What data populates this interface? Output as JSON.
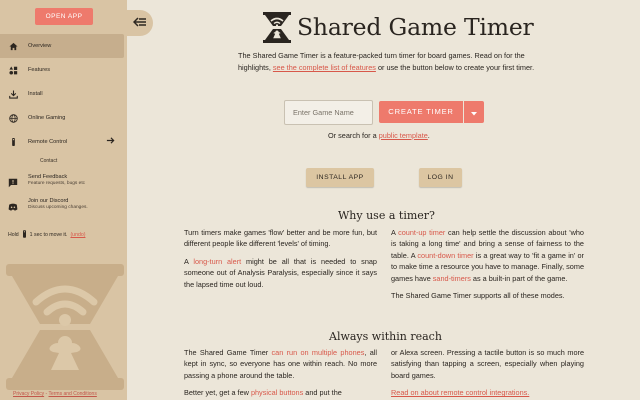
{
  "sidebar": {
    "open_app": "OPEN APP",
    "items": [
      {
        "label": "Overview",
        "icon": "home-icon"
      },
      {
        "label": "Features",
        "icon": "features-icon"
      },
      {
        "label": "Install",
        "icon": "download-icon"
      },
      {
        "label": "Online Gaming",
        "icon": "globe-icon"
      },
      {
        "label": "Remote Control",
        "icon": "remote-icon"
      }
    ],
    "contact": "Contact",
    "feedback_title": "Send Feedback",
    "feedback_sub": "Feature requests, bugs etc",
    "discord_title": "Join our Discord",
    "discord_sub": "Discuss upcoming changes.",
    "hold_text": "Hold",
    "hold_text2": "1 sec to move it.",
    "undo": "(undo)",
    "privacy": "Privacy Policy",
    "sep": " - ",
    "terms": "Terms and Conditions"
  },
  "header": {
    "title": "Shared Game Timer"
  },
  "intro": {
    "text1": "The Shared Game Timer is a feature-packed turn timer for board games. Read on for the highlights, ",
    "link": "see the complete list of features",
    "text2": " or use the button below to create your first timer."
  },
  "create": {
    "placeholder": "Enter Game Name",
    "button": "CREATE TIMER",
    "search_pre": "Or search for a ",
    "search_link": "public template",
    "search_post": "."
  },
  "actions": {
    "install": "INSTALL APP",
    "login": "LOG IN"
  },
  "why": {
    "heading": "Why use a timer?",
    "left_p1": "Turn timers make games 'flow' better and be more fun, but different people like different 'levels' of timing.",
    "left_p2_pre": "A ",
    "left_p2_link": "long-turn alert",
    "left_p2_post": " might be all that is needed to snap someone out of Analysis Paralysis, especially since it says the lapsed time out loud.",
    "right_p1_pre": "A ",
    "right_p1_link": "count-up timer",
    "right_p1_post": " can help settle the discussion about 'who is taking a long time' and bring a sense of fairness to the table. A ",
    "right_p1_link2": "count-down timer",
    "right_p1_post2": " is a great way to 'fit a game in' or to make time a resource you have to manage. Finally, some games have ",
    "right_p1_link3": "sand-timers",
    "right_p1_post3": " as a built-in part of the game.",
    "right_p2": "The Shared Game Timer supports all of these modes."
  },
  "reach": {
    "heading": "Always within reach",
    "left_p1_pre": "The Shared Game Timer ",
    "left_p1_link": "can run on multiple phones",
    "left_p1_post": ", all kept in sync, so everyone has one within reach. No more passing a phone around the table.",
    "left_p2_pre": "Better yet, get a few ",
    "left_p2_link": "physical buttons",
    "left_p2_post": " and put the",
    "right_p1": "or Alexa screen. Pressing a tactile button is so much more satisfying than tapping a screen, especially when playing board games.",
    "right_p2_link": "Read on about remote control integrations."
  }
}
